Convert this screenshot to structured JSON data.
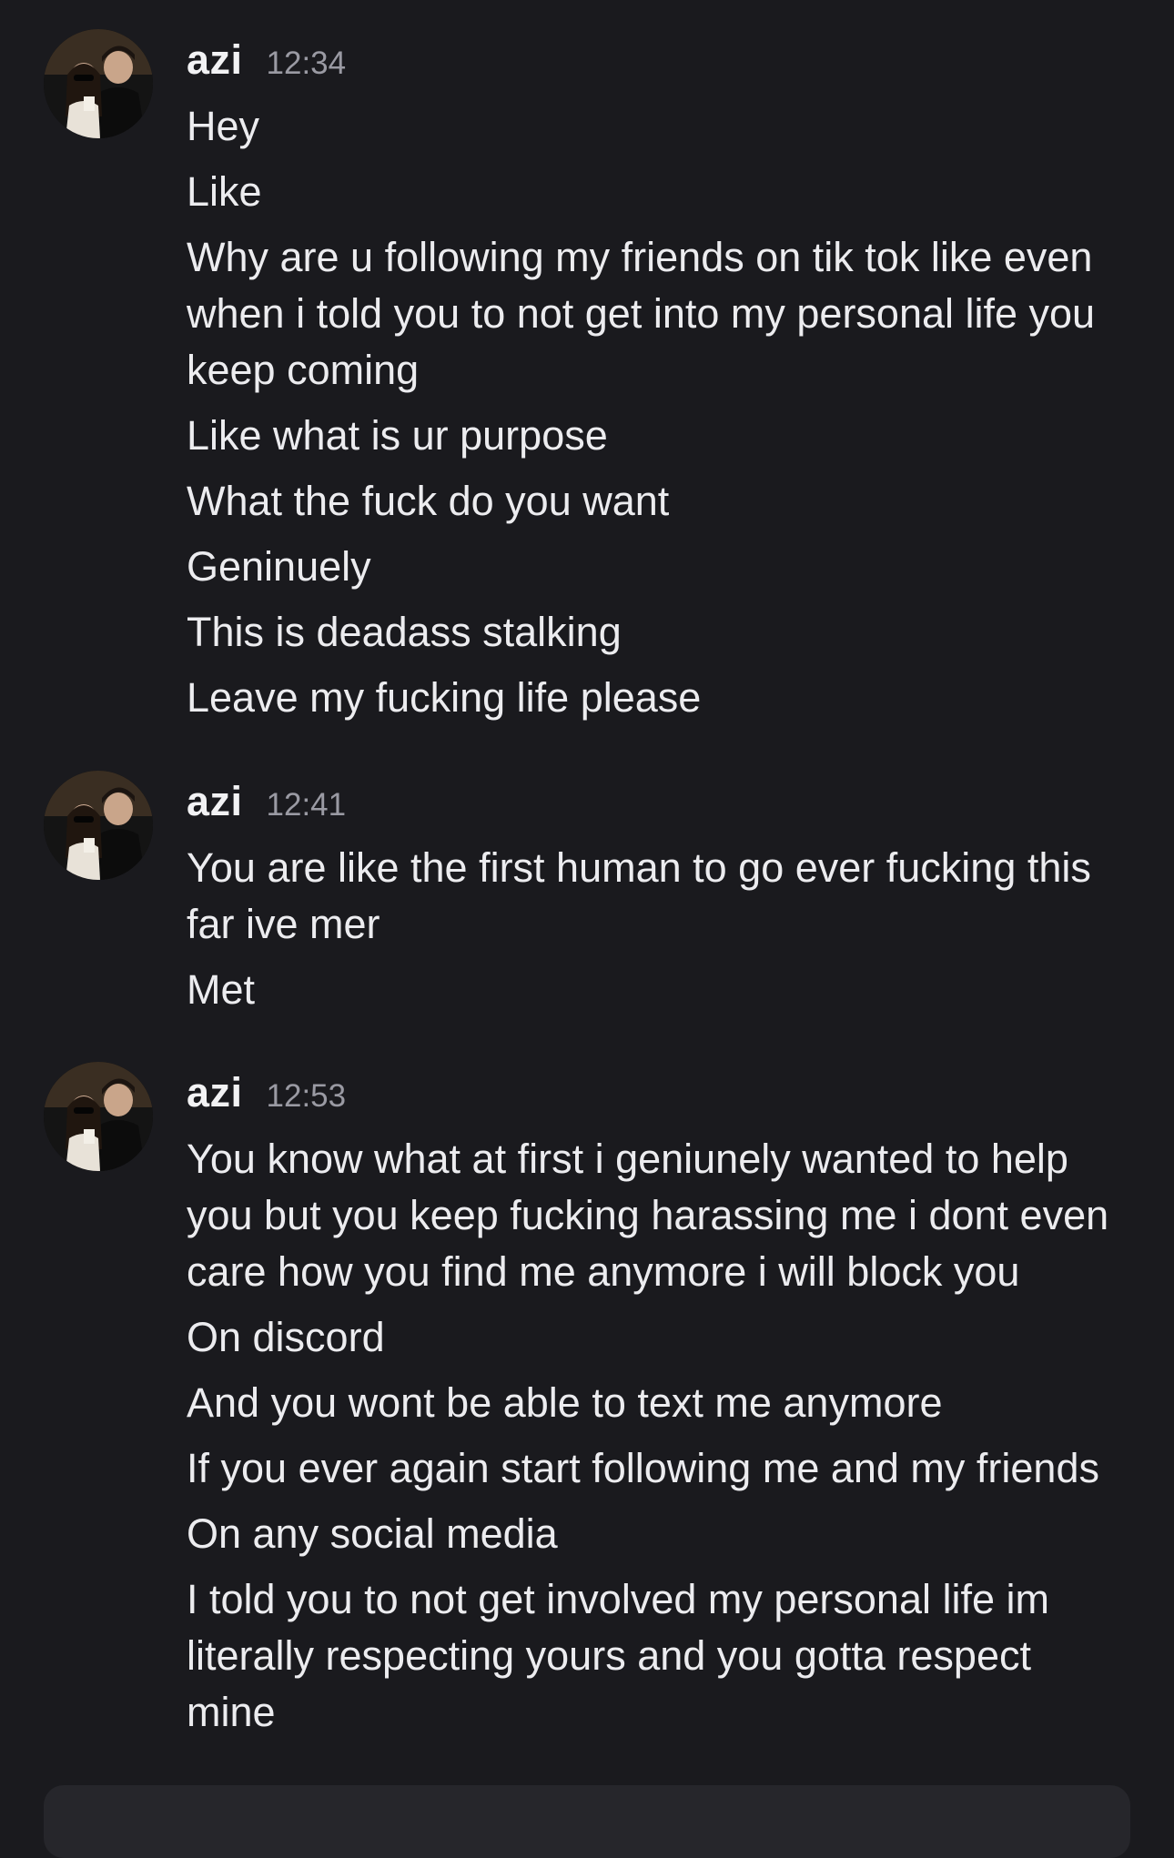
{
  "colors": {
    "background": "#1a1a1e",
    "text": "#ececef",
    "timestamp": "#9a9aa3",
    "composer": "#26262b"
  },
  "messages": [
    {
      "username": "azi",
      "time": "12:34",
      "avatar_icon": "user-avatar-photo",
      "lines": [
        "Hey",
        "Like",
        "Why are u following my friends on tik tok like even when i told you to not get into my personal life you keep coming",
        "Like what is ur purpose",
        "What the fuck do you want",
        "Geninuely",
        "This is deadass stalking",
        "Leave my fucking life please"
      ]
    },
    {
      "username": "azi",
      "time": "12:41",
      "avatar_icon": "user-avatar-photo",
      "lines": [
        "You are like the first human to go ever fucking this far ive mer",
        "Met"
      ]
    },
    {
      "username": "azi",
      "time": "12:53",
      "avatar_icon": "user-avatar-photo",
      "lines": [
        "You know what at first i geniunely wanted to help you but you keep fucking harassing me i dont even care how you find me anymore i will block you",
        "On discord",
        "And you wont be able to text me anymore",
        "If you ever again start following me and my friends",
        "On any social media",
        "I told you to not get involved my personal life im literally respecting yours and you gotta respect mine"
      ]
    }
  ]
}
